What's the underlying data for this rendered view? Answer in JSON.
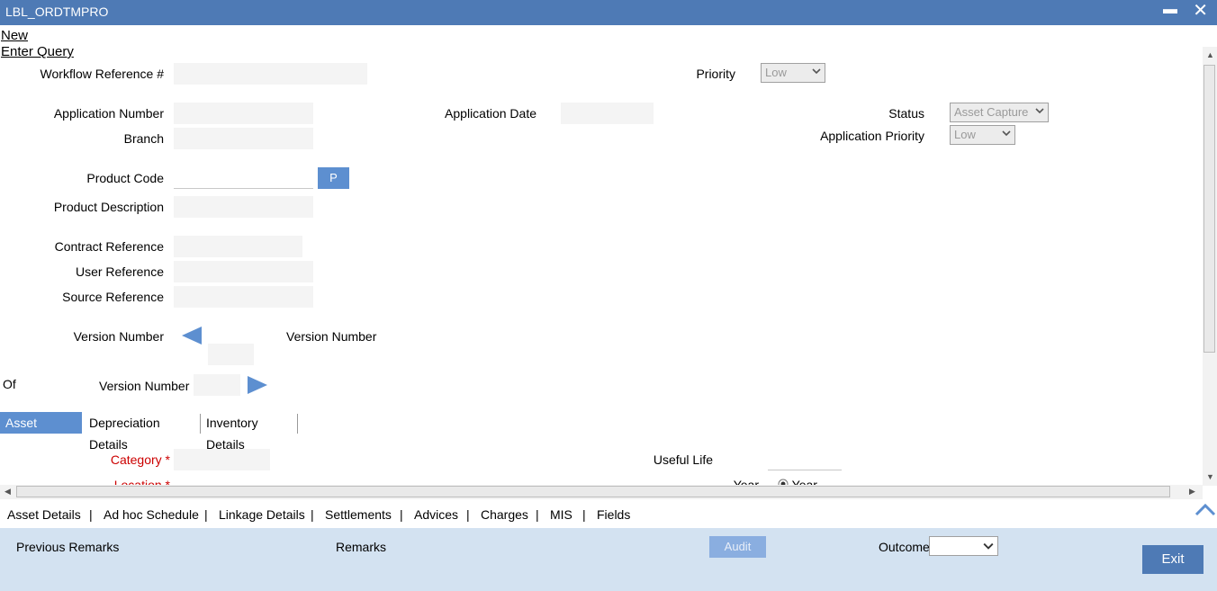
{
  "window": {
    "title": "LBL_ORDTMPRO",
    "minimize_glyph": "▬",
    "close_glyph": "✕"
  },
  "actions": {
    "new": "New",
    "enter_query": "Enter Query"
  },
  "form": {
    "workflow_ref_label": "Workflow Reference #",
    "priority_label": "Priority",
    "priority_value": "Low",
    "app_number_label": "Application Number",
    "app_date_label": "Application Date",
    "status_label": "Status",
    "status_value": "Asset Capture",
    "branch_label": "Branch",
    "app_priority_label": "Application Priority",
    "app_priority_value": "Low",
    "product_code_label": "Product Code",
    "p_button": "P",
    "product_desc_label": "Product Description",
    "contract_ref_label": "Contract Reference",
    "user_ref_label": "User Reference",
    "source_ref_label": "Source Reference",
    "version_number_label": "Version Number",
    "version_number_label2": "Version Number",
    "of_label": "Of",
    "version_number_label3": "Version Number"
  },
  "tabs": [
    "Asset Details",
    "Depreciation Details",
    "Inventory Details"
  ],
  "asset": {
    "category_label": "Category",
    "location_label": "Location",
    "required_mark": "*",
    "useful_life_label": "Useful Life",
    "year_label": "Year",
    "year_radio_label": "Year"
  },
  "nav": [
    "Asset Details",
    "Ad hoc Schedule",
    "Linkage Details",
    "Settlements",
    "Advices",
    "Charges",
    "MIS",
    "Fields"
  ],
  "nav_separator": "|",
  "footer": {
    "previous_remarks": "Previous Remarks",
    "remarks": "Remarks",
    "audit": "Audit",
    "outcome": "Outcome",
    "outcome_value": "",
    "exit": "Exit"
  },
  "colors": {
    "titlebar": "#4e7ab5",
    "accent": "#5d8fd0",
    "footer": "#d3e2f1",
    "required": "#cc0000"
  },
  "icons": {
    "left_arrow": "triangle-left-icon",
    "right_arrow": "triangle-right-icon",
    "up_chevron": "chevron-up-icon"
  }
}
